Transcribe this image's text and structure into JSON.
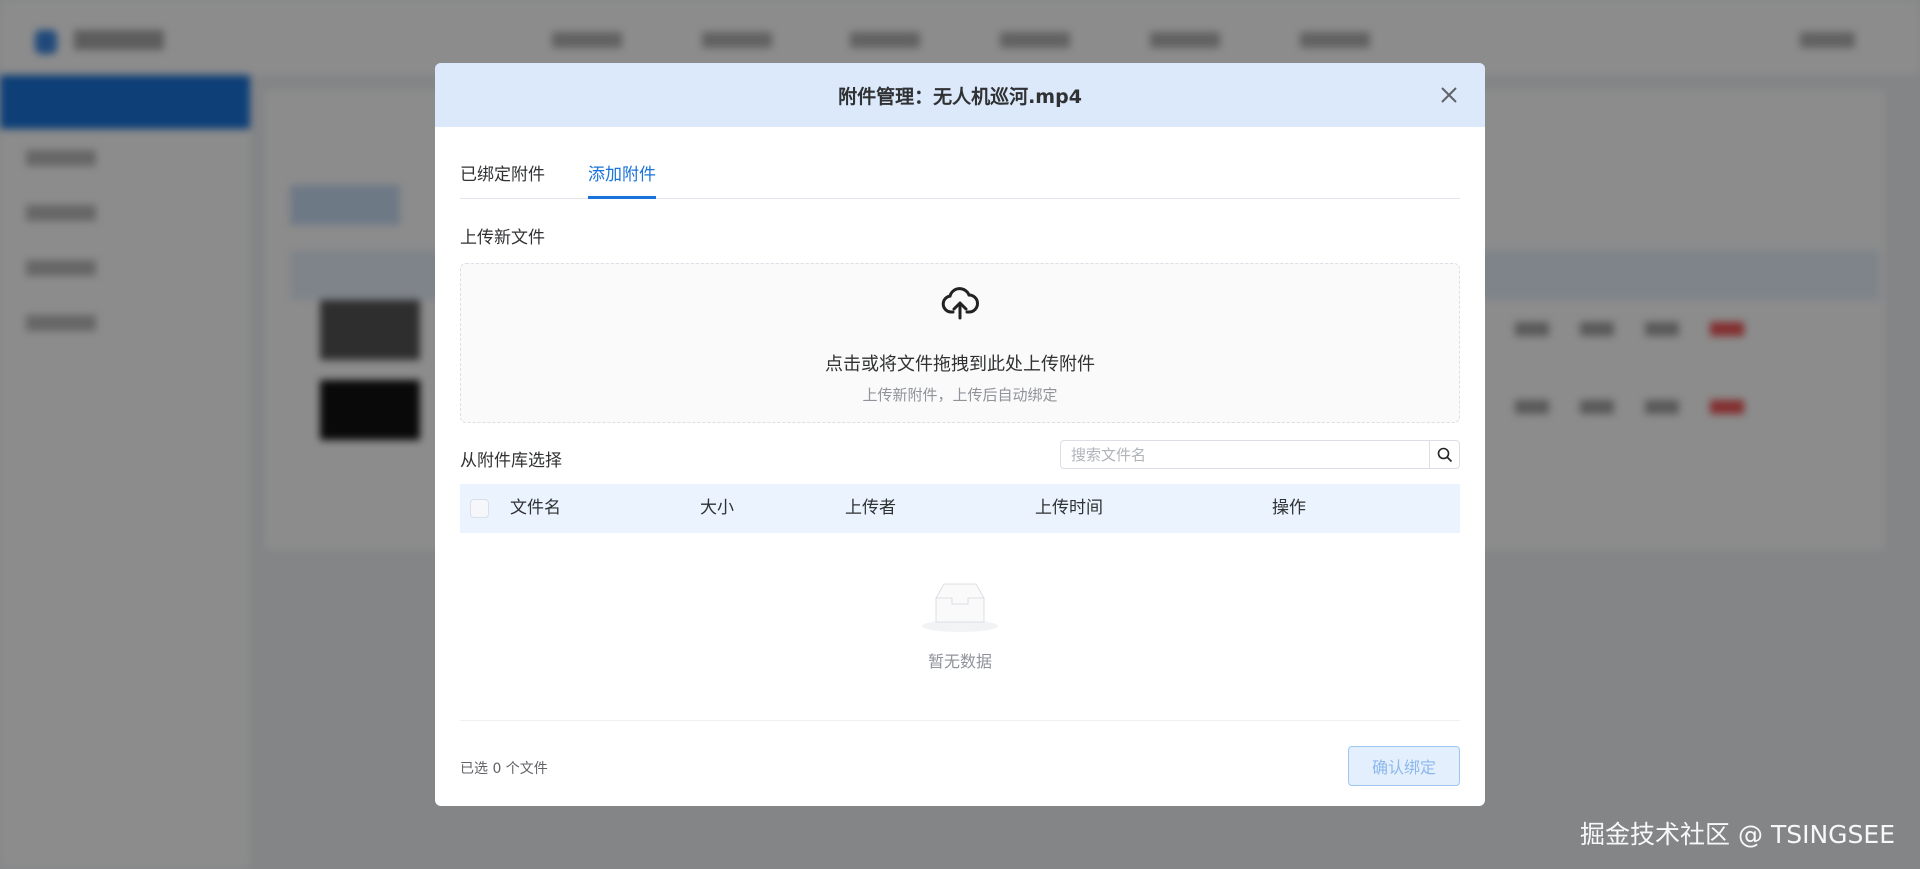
{
  "modal": {
    "title": "附件管理：无人机巡河.mp4",
    "tabs": [
      {
        "label": "已绑定附件"
      },
      {
        "label": "添加附件",
        "active": true
      }
    ],
    "upload": {
      "section_label": "上传新文件",
      "drop_text": "点击或将文件拖拽到此处上传附件",
      "drop_subtext": "上传新附件，上传后自动绑定"
    },
    "library": {
      "section_label": "从附件库选择",
      "search_placeholder": "搜索文件名",
      "columns": [
        "文件名",
        "大小",
        "上传者",
        "上传时间",
        "操作"
      ],
      "rows": [],
      "empty_text": "暂无数据"
    },
    "footer": {
      "selected_text": "已选 0 个文件",
      "confirm_label": "确认绑定"
    }
  },
  "watermark": "掘金技术社区 @ TSINGSEE",
  "colors": {
    "accent": "#1a73d9",
    "header_bg": "#dbe9fb"
  }
}
